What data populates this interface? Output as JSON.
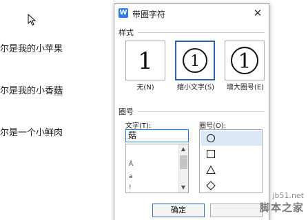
{
  "document": {
    "lines": [
      {
        "before": "尔是我的小苹果",
        "highlight": ""
      },
      {
        "before": "尔是我的小香",
        "highlight": "菇"
      },
      {
        "before": "尔是一个小鲜肉",
        "highlight": ""
      }
    ]
  },
  "dialog": {
    "title": "带圈字符",
    "app_icon": "W",
    "close_glyph": "✕",
    "style_section": "样式",
    "style_options": [
      {
        "glyph": "1",
        "label": "无(N)",
        "selected": false
      },
      {
        "glyph": "①",
        "label": "缩小文字(S)",
        "selected": true
      },
      {
        "glyph": "①",
        "label": "增大圈号(E)",
        "selected": false
      }
    ],
    "enclosure_section": "圈号",
    "text_label": "文字(T):",
    "text_value": "菇",
    "char_list": [
      "Á",
      "a",
      "!"
    ],
    "enclosure_label": "圈号(O):",
    "enclosures": [
      "circle",
      "square",
      "triangle",
      "diamond"
    ],
    "ok_label": "确定"
  },
  "watermark": {
    "url": "jb51.net",
    "name": "脚本之家"
  }
}
